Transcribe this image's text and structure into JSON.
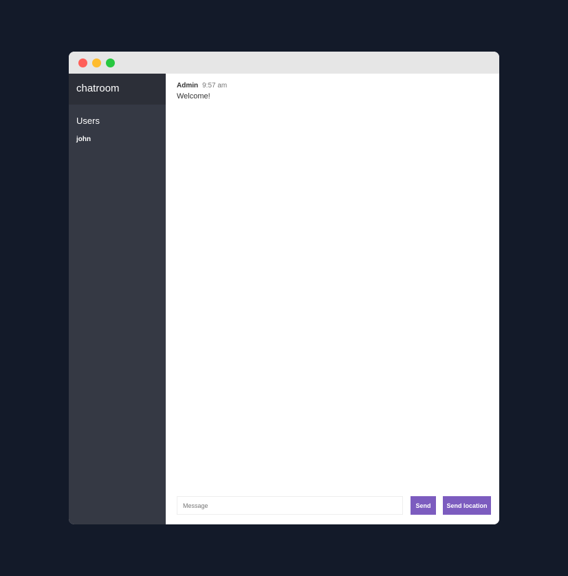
{
  "window": {
    "controls": [
      "close",
      "minimize",
      "maximize"
    ]
  },
  "sidebar": {
    "room_name": "chatroom",
    "users_title": "Users",
    "users": [
      "john"
    ]
  },
  "chat": {
    "messages": [
      {
        "name": "Admin",
        "time": "9:57 am",
        "text": "Welcome!"
      }
    ]
  },
  "composer": {
    "placeholder": "Message",
    "value": "",
    "send_label": "Send",
    "location_label": "Send location"
  },
  "colors": {
    "background": "#131a29",
    "sidebar": "#353944",
    "sidebar_header": "#2c2f38",
    "accent": "#7c5cbf"
  }
}
